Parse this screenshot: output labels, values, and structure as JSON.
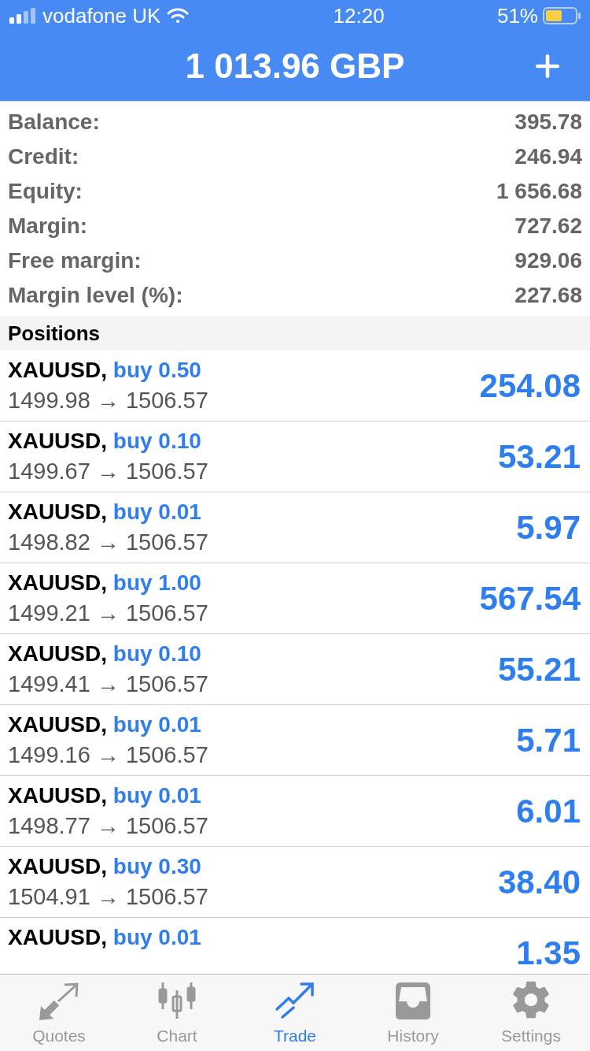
{
  "status_bar": {
    "carrier": "vodafone UK",
    "time": "12:20",
    "battery": "51%"
  },
  "header": {
    "title": "1 013.96 GBP"
  },
  "summary": [
    {
      "label": "Balance:",
      "value": "395.78"
    },
    {
      "label": "Credit:",
      "value": "246.94"
    },
    {
      "label": "Equity:",
      "value": "1 656.68"
    },
    {
      "label": "Margin:",
      "value": "727.62"
    },
    {
      "label": "Free margin:",
      "value": "929.06"
    },
    {
      "label": "Margin level (%):",
      "value": "227.68"
    }
  ],
  "positions": {
    "title": "Positions",
    "rows": [
      {
        "symbol": "XAUUSD,",
        "order": "buy 0.50",
        "prices": "1499.98 → 1506.57",
        "profit": "254.08"
      },
      {
        "symbol": "XAUUSD,",
        "order": "buy 0.10",
        "prices": "1499.67 → 1506.57",
        "profit": "53.21"
      },
      {
        "symbol": "XAUUSD,",
        "order": "buy 0.01",
        "prices": "1498.82 → 1506.57",
        "profit": "5.97"
      },
      {
        "symbol": "XAUUSD,",
        "order": "buy 1.00",
        "prices": "1499.21 → 1506.57",
        "profit": "567.54"
      },
      {
        "symbol": "XAUUSD,",
        "order": "buy 0.10",
        "prices": "1499.41 → 1506.57",
        "profit": "55.21"
      },
      {
        "symbol": "XAUUSD,",
        "order": "buy 0.01",
        "prices": "1499.16 → 1506.57",
        "profit": "5.71"
      },
      {
        "symbol": "XAUUSD,",
        "order": "buy 0.01",
        "prices": "1498.77 → 1506.57",
        "profit": "6.01"
      },
      {
        "symbol": "XAUUSD,",
        "order": "buy 0.30",
        "prices": "1504.91 → 1506.57",
        "profit": "38.40"
      },
      {
        "symbol": "XAUUSD,",
        "order": "buy 0.01",
        "profit": "1.35"
      }
    ]
  },
  "tabs": [
    {
      "label": "Quotes",
      "selected": false
    },
    {
      "label": "Chart",
      "selected": false
    },
    {
      "label": "Trade",
      "selected": true
    },
    {
      "label": "History",
      "selected": false
    },
    {
      "label": "Settings",
      "selected": false
    }
  ]
}
